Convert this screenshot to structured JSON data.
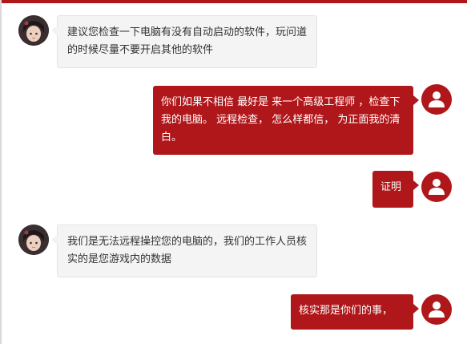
{
  "colors": {
    "accent": "#b0171a",
    "support_bubble": "#f4f4f4",
    "support_text": "#333333",
    "user_text": "#ffffff"
  },
  "messages": [
    {
      "sender": "support",
      "avatar": "support-avatar-icon",
      "text": "建议您检查一下电脑有没有自动启动的软件，玩问道的时候尽量不要开启其他的软件"
    },
    {
      "sender": "user",
      "avatar": "user-icon",
      "text": "你们如果不相信 最好是 来一个高级工程师 ，检查下我的电脑。 远程检查， 怎么样都信， 为正面我的清白。"
    },
    {
      "sender": "user",
      "avatar": "user-icon",
      "text": "证明"
    },
    {
      "sender": "support",
      "avatar": "support-avatar-icon",
      "text": "我们是无法远程操控您的电脑的，我们的工作人员核实的是您游戏内的数据"
    },
    {
      "sender": "user",
      "avatar": "user-icon",
      "text": "核实那是你们的事，"
    }
  ]
}
